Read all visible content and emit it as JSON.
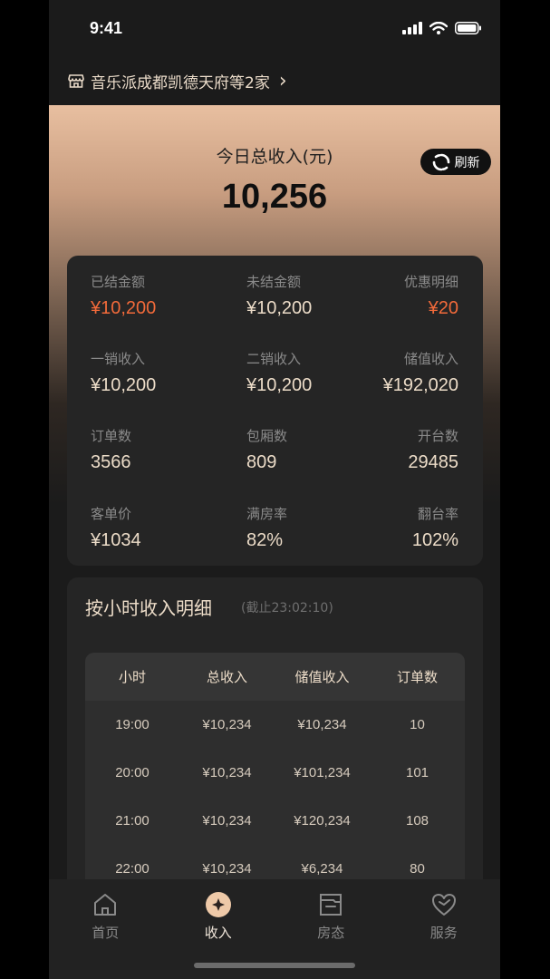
{
  "status_bar": {
    "time": "9:41"
  },
  "store": {
    "name": "音乐派成都凯德天府等2家",
    "chevron": "›"
  },
  "summary": {
    "title": "今日总收入(元)",
    "value": "10,256",
    "refresh_label": "刷新"
  },
  "stats": [
    {
      "label": "已结金额",
      "value": "¥10,200",
      "accent": true
    },
    {
      "label": "未结金额",
      "value": "¥10,200",
      "accent": false
    },
    {
      "label": "优惠明细",
      "value": "¥20",
      "accent": true
    },
    {
      "label": "一销收入",
      "value": "¥10,200",
      "accent": false
    },
    {
      "label": "二销收入",
      "value": "¥10,200",
      "accent": false
    },
    {
      "label": "储值收入",
      "value": "¥192,020",
      "accent": false
    },
    {
      "label": "订单数",
      "value": "3566",
      "accent": false
    },
    {
      "label": "包厢数",
      "value": "809",
      "accent": false
    },
    {
      "label": "开台数",
      "value": "29485",
      "accent": false
    },
    {
      "label": "客单价",
      "value": "¥1034",
      "accent": false
    },
    {
      "label": "满房率",
      "value": "82%",
      "accent": false
    },
    {
      "label": "翻台率",
      "value": "102%",
      "accent": false
    }
  ],
  "hourly": {
    "title": "按小时收入明细",
    "subtitle": "(截止23:02:10)",
    "columns": [
      "小时",
      "总收入",
      "储值收入",
      "订单数"
    ],
    "rows": [
      [
        "19:00",
        "¥10,234",
        "¥10,234",
        "10"
      ],
      [
        "20:00",
        "¥10,234",
        "¥101,234",
        "101"
      ],
      [
        "21:00",
        "¥10,234",
        "¥120,234",
        "108"
      ],
      [
        "22:00",
        "¥10,234",
        "¥6,234",
        "80"
      ]
    ]
  },
  "tabs": [
    {
      "label": "首页",
      "icon": "home-icon",
      "active": false
    },
    {
      "label": "收入",
      "icon": "income-icon",
      "active": true
    },
    {
      "label": "房态",
      "icon": "room-status-icon",
      "active": false
    },
    {
      "label": "服务",
      "icon": "service-heart-icon",
      "active": false
    }
  ],
  "colors": {
    "accent": "#f26a3a",
    "gold_text": "#ecdcc8",
    "background": "#1b1b1b"
  }
}
